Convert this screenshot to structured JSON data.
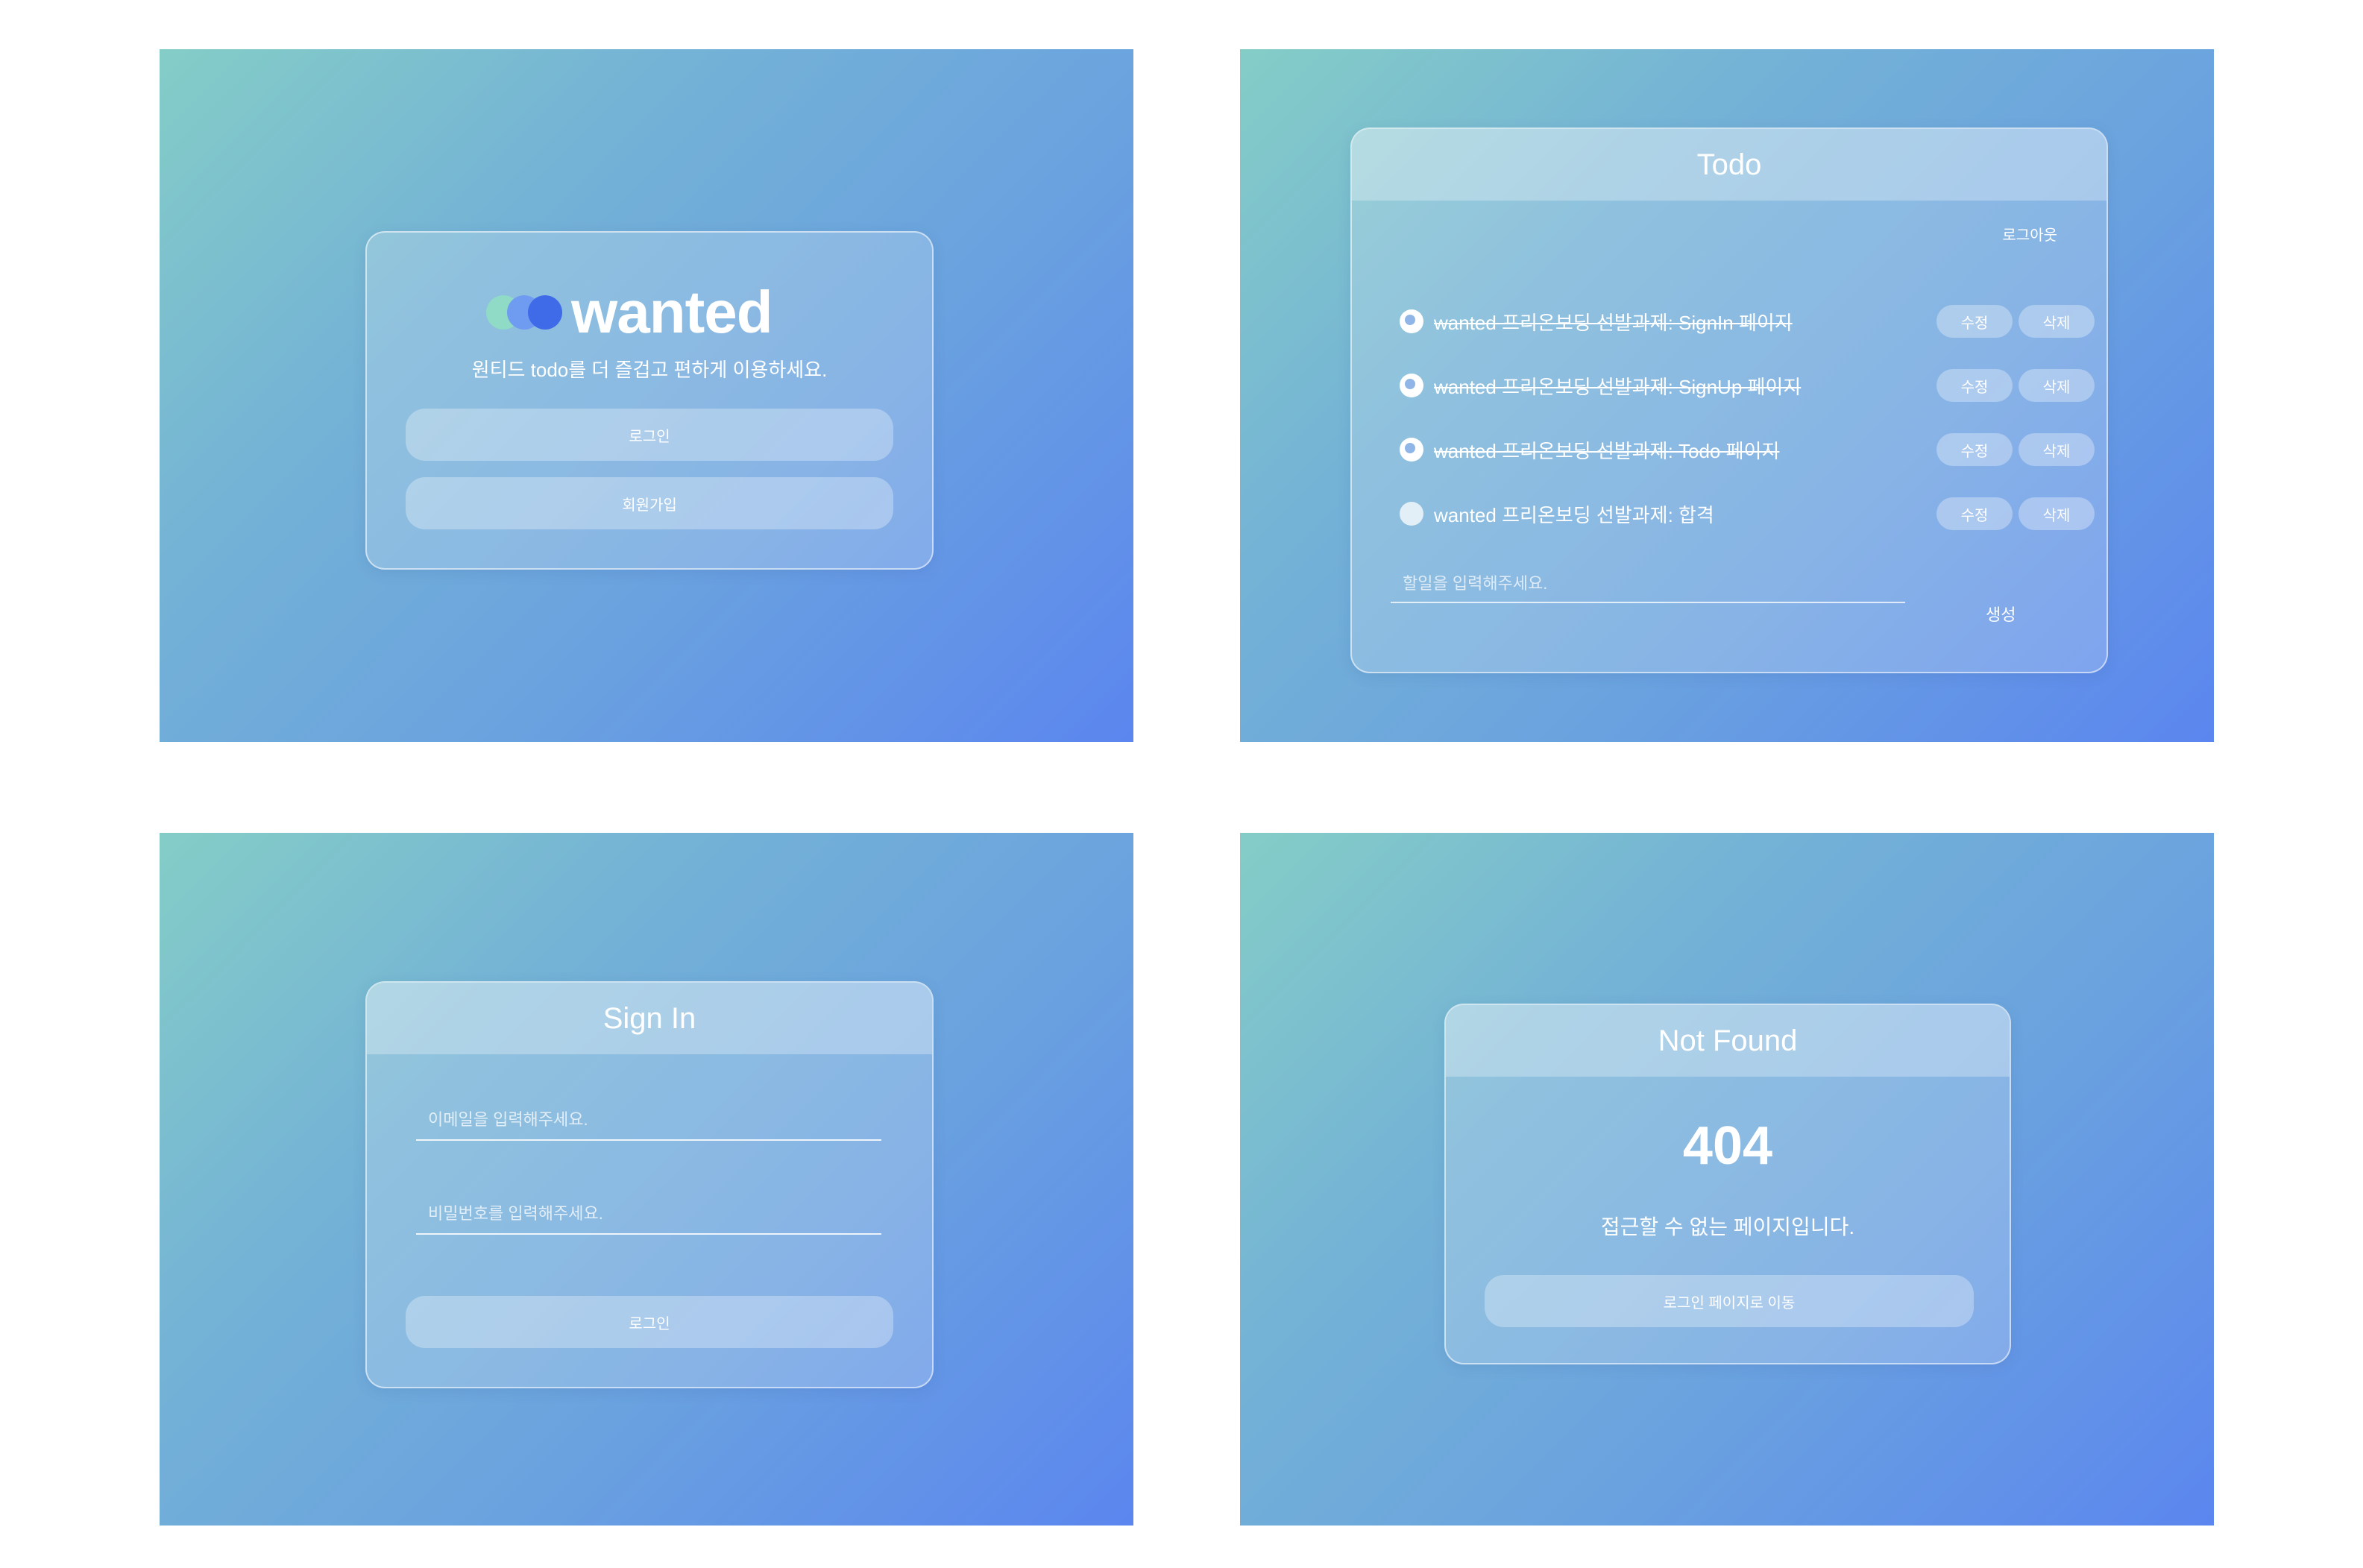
{
  "landing": {
    "logo_text": "wanted",
    "subtitle": "원티드 todo를 더 즐겁고 편하게 이용하세요.",
    "login_label": "로그인",
    "signup_label": "회원가입"
  },
  "todo": {
    "title": "Todo",
    "logout_label": "로그아웃",
    "items": [
      {
        "text": "wanted 프리온보딩 선발과제: SignIn 페이지",
        "completed": true,
        "edit_label": "수정",
        "delete_label": "삭제"
      },
      {
        "text": "wanted 프리온보딩 선발과제: SignUp 페이지",
        "completed": true,
        "edit_label": "수정",
        "delete_label": "삭제"
      },
      {
        "text": "wanted 프리온보딩 선발과제: Todo 페이지",
        "completed": true,
        "edit_label": "수정",
        "delete_label": "삭제"
      },
      {
        "text": "wanted 프리온보딩 선발과제: 합격",
        "completed": false,
        "edit_label": "수정",
        "delete_label": "삭제"
      }
    ],
    "input_placeholder": "할일을 입력해주세요.",
    "create_label": "생성"
  },
  "signin": {
    "title": "Sign In",
    "email_placeholder": "이메일을 입력해주세요.",
    "password_placeholder": "비밀번호를 입력해주세요.",
    "login_label": "로그인"
  },
  "notfound": {
    "title": "Not Found",
    "code": "404",
    "message": "접근할 수 없는 페이지입니다.",
    "button_label": "로그인 페이지로 이동"
  },
  "colors": {
    "gradient_start": "#84cdc7",
    "gradient_end": "#5b86ef",
    "logo_dot_1": "#8fdcc4",
    "logo_dot_2": "#6f9bf0",
    "logo_dot_3": "#3f6be8"
  }
}
